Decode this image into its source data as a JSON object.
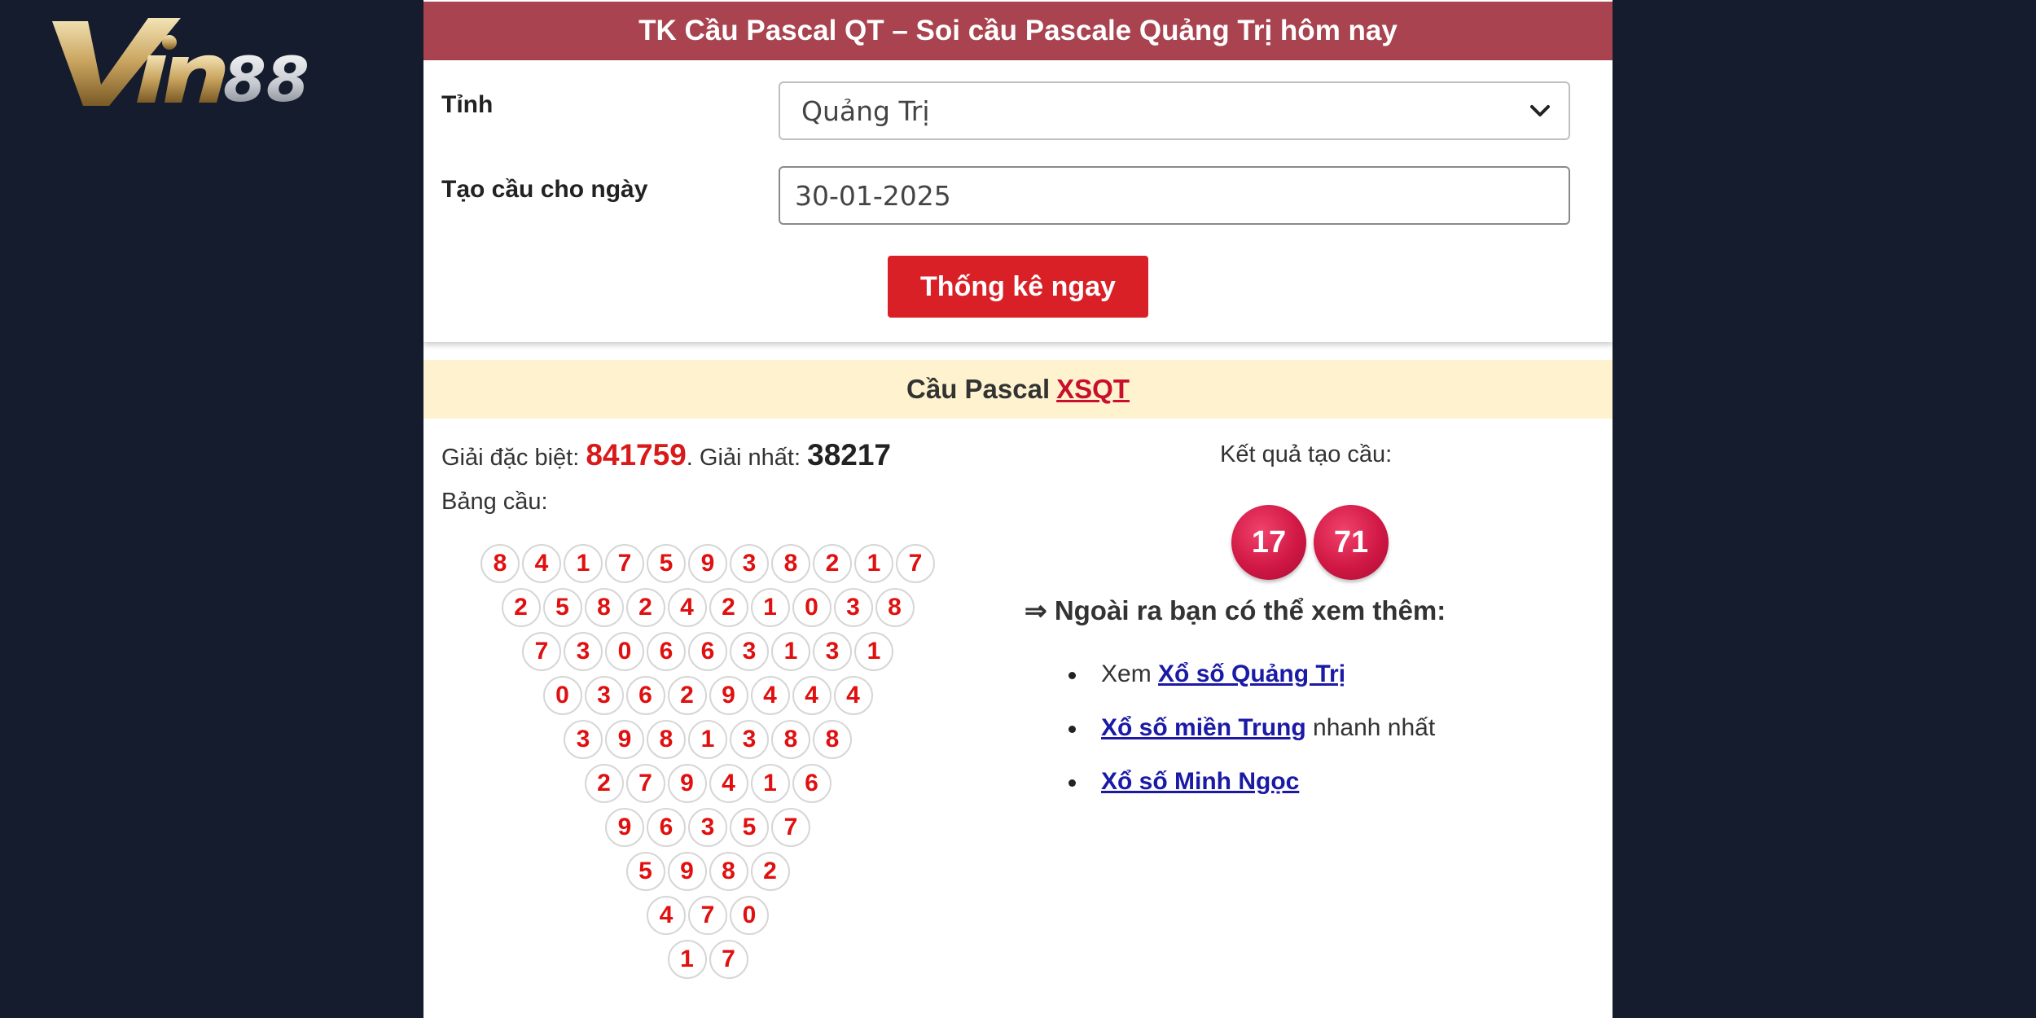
{
  "brand": {
    "logo_text": "Vin88",
    "bg_color": "#141c2d"
  },
  "header": {
    "title": "TK Cầu Pascal QT – Soi cầu Pascale Quảng Trị hôm nay"
  },
  "form": {
    "province_label": "Tỉnh",
    "province_value": "Quảng Trị",
    "date_label": "Tạo cầu cho ngày",
    "date_value": "30-01-2025",
    "submit_label": "Thống kê ngay"
  },
  "section": {
    "prefix": "Cầu Pascal",
    "link_text": "XSQT"
  },
  "prizes": {
    "special_label": "Giải đặc biệt:",
    "special_value": "841759",
    "separator": ".",
    "first_label": "Giải nhất:",
    "first_value": "38217"
  },
  "table": {
    "label": "Bảng cầu:",
    "rows": [
      [
        "8",
        "4",
        "1",
        "7",
        "5",
        "9",
        "3",
        "8",
        "2",
        "1",
        "7"
      ],
      [
        "2",
        "5",
        "8",
        "2",
        "4",
        "2",
        "1",
        "0",
        "3",
        "8"
      ],
      [
        "7",
        "3",
        "0",
        "6",
        "6",
        "3",
        "1",
        "3",
        "1"
      ],
      [
        "0",
        "3",
        "6",
        "2",
        "9",
        "4",
        "4",
        "4"
      ],
      [
        "3",
        "9",
        "8",
        "1",
        "3",
        "8",
        "8"
      ],
      [
        "2",
        "7",
        "9",
        "4",
        "1",
        "6"
      ],
      [
        "9",
        "6",
        "3",
        "5",
        "7"
      ],
      [
        "5",
        "9",
        "8",
        "2"
      ],
      [
        "4",
        "7",
        "0"
      ],
      [
        "1",
        "7"
      ]
    ]
  },
  "result": {
    "label": "Kết quả tạo cầu:",
    "values": [
      "17",
      "71"
    ]
  },
  "more": {
    "title": "⇒ Ngoài ra bạn có thể xem thêm:",
    "items": [
      {
        "prefix": "Xem ",
        "link": "Xổ số Quảng Trị",
        "suffix": ""
      },
      {
        "prefix": "",
        "link": "Xổ số miền Trung",
        "suffix": " nhanh nhất"
      },
      {
        "prefix": "",
        "link": "Xổ số Minh Ngọc",
        "suffix": ""
      }
    ]
  },
  "colors": {
    "header_bar": "#a8434f",
    "button": "#d92027",
    "digit": "#e01010",
    "result_ball": "#d11845",
    "section_bg": "#fff3cf"
  }
}
